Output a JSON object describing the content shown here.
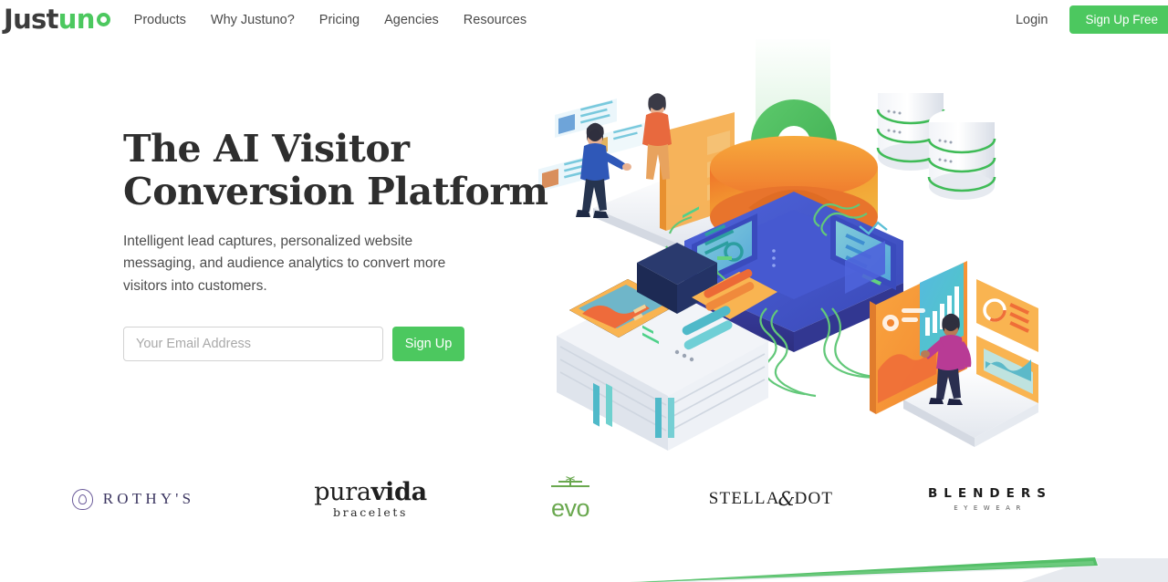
{
  "header": {
    "logo": {
      "part1": "Just",
      "part2": "un",
      "dot_icon": "logo-dot-icon"
    },
    "nav": [
      {
        "label": "Products"
      },
      {
        "label": "Why Justuno?"
      },
      {
        "label": "Pricing"
      },
      {
        "label": "Agencies"
      },
      {
        "label": "Resources"
      }
    ],
    "login_label": "Login",
    "signup_free_label": "Sign Up Free"
  },
  "hero": {
    "title_line1": "The AI Visitor",
    "title_line2": "Conversion Platform",
    "subtitle": "Intelligent lead captures, personalized website messaging, and audience analytics to convert more visitors into customers.",
    "email_placeholder": "Your Email Address",
    "email_value": "",
    "signup_button_label": "Sign Up",
    "illustration_name": "isometric-data-funnel-illustration"
  },
  "brands": {
    "rothys": {
      "text": "ROTHY'S",
      "icon": "rothys-shield-icon"
    },
    "puravida": {
      "light": "pura",
      "bold": "vida",
      "sub": "bracelets"
    },
    "evo": {
      "text": "evo",
      "icon": "evo-tree-icon"
    },
    "stella": {
      "part1": "STELLA",
      "amp": "&",
      "part2": "DOT"
    },
    "blenders": {
      "main": "BLENDERS",
      "sub": "EYEWEAR"
    }
  },
  "colors": {
    "brand_green": "#4cc85f",
    "accent_green_line": "#54bf68",
    "text_dark": "#2e2e2e",
    "text_body": "#4d4d4d",
    "nav_text": "#4a4a4a",
    "input_border": "#d3d3d3",
    "placeholder": "#a9a9a9",
    "band_gray": "#e7eaef",
    "illustration_orange": "#f0922f",
    "illustration_blue": "#3b4fc4",
    "illustration_purple": "#5a3fc0"
  }
}
